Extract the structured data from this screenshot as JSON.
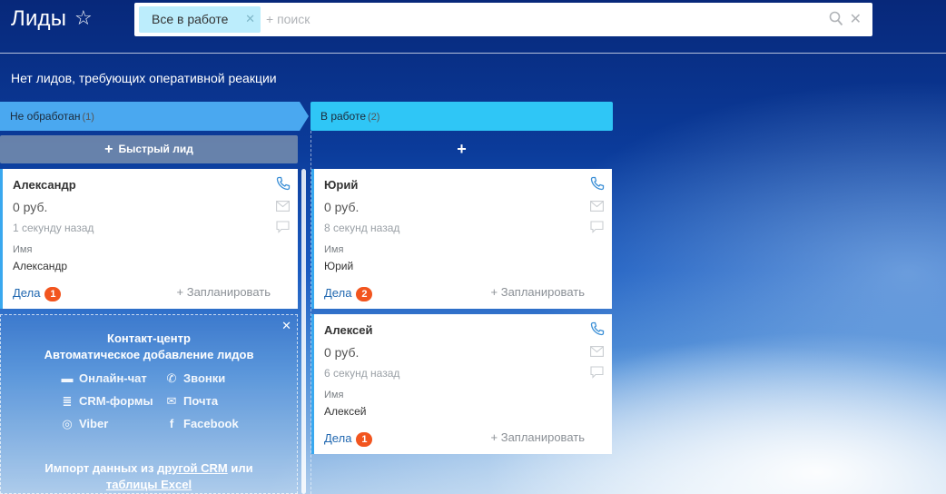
{
  "header": {
    "title": "Лиды",
    "star_icon": "star-outline-icon",
    "filter_chip": "Все в работе",
    "search_placeholder": "+ поиск"
  },
  "notice": "Нет лидов, требующих оперативной реакции",
  "stages": [
    {
      "label": "Не обработан",
      "count": "(1)",
      "color": "#4aa8f0"
    },
    {
      "label": "В работе",
      "count": "(2)",
      "color": "#2fc6f6"
    }
  ],
  "quick_lead_label": "Быстрый лид",
  "add_label": "+",
  "cards": [
    {
      "name": "Александр",
      "price": "0 руб.",
      "time": "1 секунду назад",
      "field_label": "Имя",
      "field_value": "Александр",
      "deals_label": "Дела",
      "deals_count": "1",
      "plan_label": "+ Запланировать"
    },
    {
      "name": "Юрий",
      "price": "0 руб.",
      "time": "8 секунд назад",
      "field_label": "Имя",
      "field_value": "Юрий",
      "deals_label": "Дела",
      "deals_count": "2",
      "plan_label": "+ Запланировать"
    },
    {
      "name": "Алексей",
      "price": "0 руб.",
      "time": "6 секунд назад",
      "field_label": "Имя",
      "field_value": "Алексей",
      "deals_label": "Дела",
      "deals_count": "1",
      "plan_label": "+ Запланировать"
    }
  ],
  "promo": {
    "title_line1": "Контакт-центр",
    "title_line2": "Автоматическое добавление лидов",
    "items": {
      "chat": "Онлайн-чат",
      "calls": "Звонки",
      "crm_forms": "CRM-формы",
      "mail": "Почта",
      "viber": "Viber",
      "facebook": "Facebook"
    },
    "import_prefix": "Импорт данных из",
    "import_link1": "другой CRM",
    "import_middle": "или",
    "import_link2": "таблицы Excel"
  }
}
